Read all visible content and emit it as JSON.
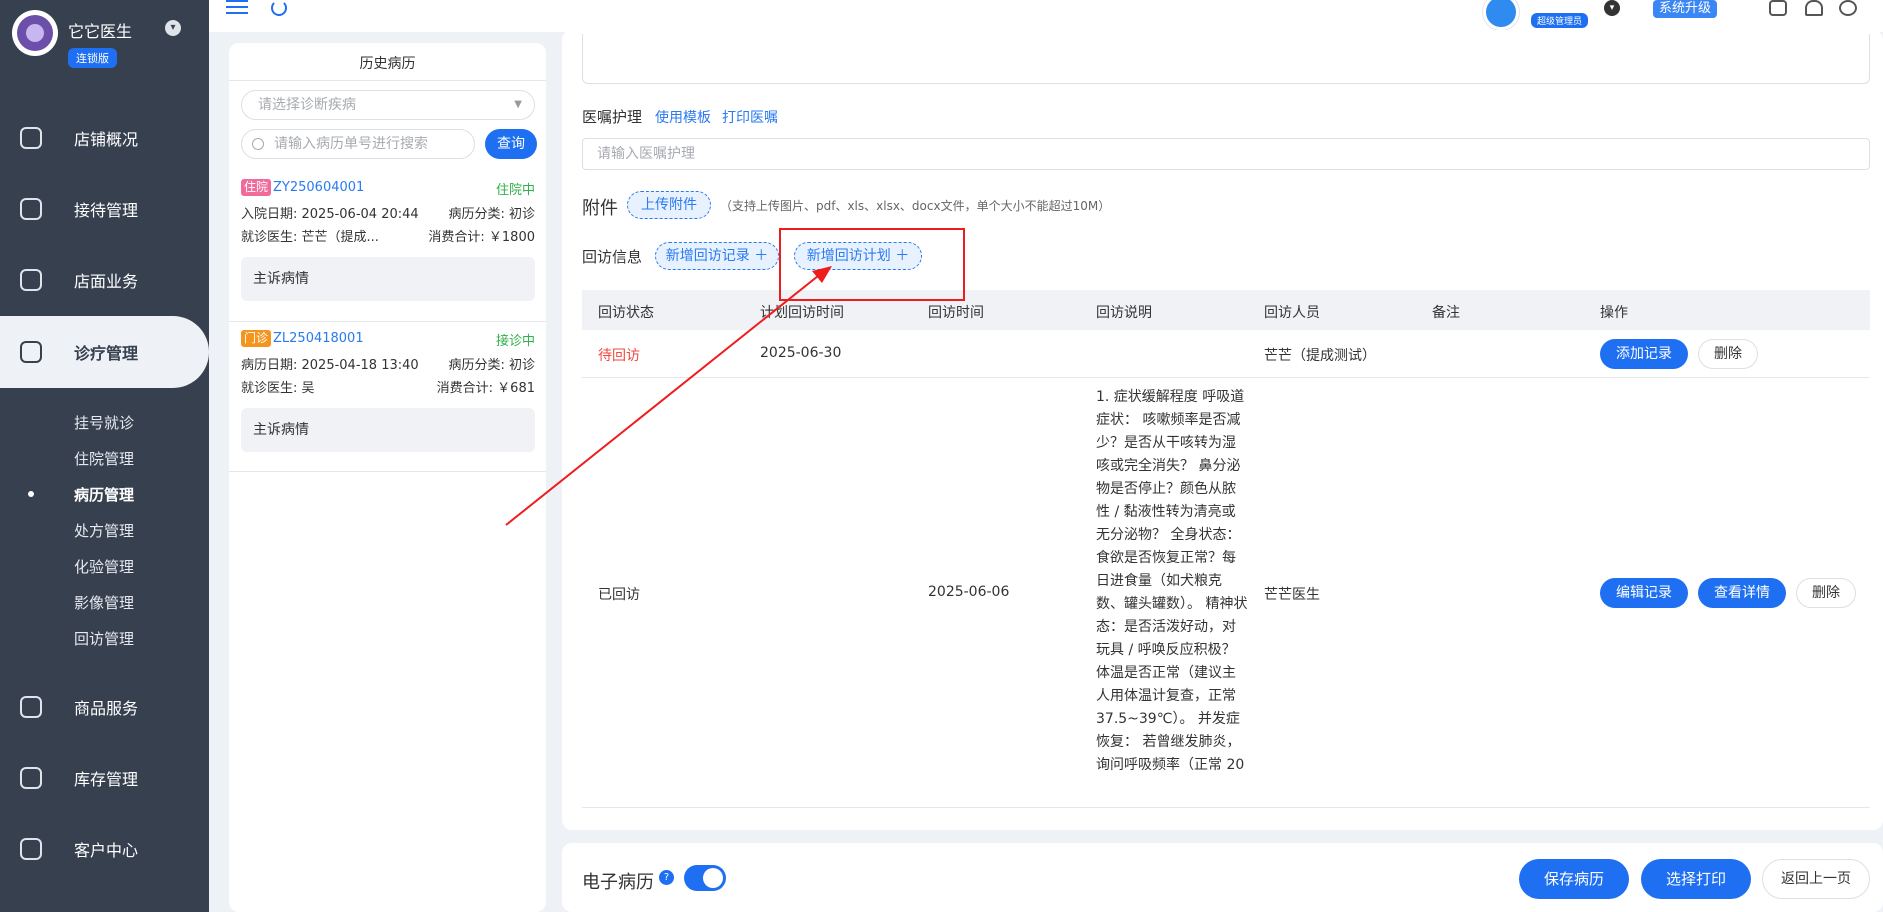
{
  "brand": {
    "name": "它它医生",
    "edition": "连锁版"
  },
  "sidebar": {
    "items": [
      {
        "label": "店铺概况",
        "icon": "dashboard-icon"
      },
      {
        "label": "接待管理",
        "icon": "reception-icon"
      },
      {
        "label": "店面业务",
        "icon": "store-icon"
      },
      {
        "label": "诊疗管理",
        "icon": "medical-kit-icon"
      },
      {
        "label": "商品服务",
        "icon": "goods-icon"
      },
      {
        "label": "库存管理",
        "icon": "inventory-icon"
      },
      {
        "label": "客户中心",
        "icon": "customer-icon"
      }
    ],
    "sub_items": [
      "挂号就诊",
      "住院管理",
      "病历管理",
      "处方管理",
      "化验管理",
      "影像管理",
      "回访管理"
    ]
  },
  "topbar": {
    "role_badge": "超级管理员",
    "upgrade": "系统升级"
  },
  "history": {
    "title": "历史病历",
    "select_placeholder": "请选择诊断疾病",
    "search_placeholder": "请输入病历单号进行搜索",
    "query_label": "查询",
    "records": [
      {
        "tag": "住院",
        "no": "ZY250604001",
        "status": "住院中",
        "date_line": "入院日期: 2025-06-04 20:44",
        "category": "病历分类: 初诊",
        "doctor": "就诊医生: 芒芒（提成...",
        "total": "消费合计: ￥1800",
        "complaint": "主诉病情"
      },
      {
        "tag": "门诊",
        "no": "ZL250418001",
        "status": "接诊中",
        "date_line": "病历日期: 2025-04-18 13:40",
        "category": "病历分类: 初诊",
        "doctor": "就诊医生: 吴",
        "total": "消费合计: ￥681",
        "complaint": "主诉病情"
      }
    ]
  },
  "main": {
    "care_label": "医嘱护理",
    "use_template": "使用模板",
    "print_care": "打印医嘱",
    "care_placeholder": "请输入医嘱护理",
    "attach_label": "附件",
    "upload_label": "上传附件",
    "upload_hint": "（支持上传图片、pdf、xls、xlsx、docx文件，单个大小不能超过10M）",
    "visit_label": "回访信息",
    "add_visit_record": "新增回访记录 ＋",
    "add_visit_plan": "新增回访计划 ＋",
    "table": {
      "headers": [
        "回访状态",
        "计划回访时间",
        "回访时间",
        "回访说明",
        "回访人员",
        "备注",
        "操作"
      ],
      "rows": [
        {
          "status": "待回访",
          "plan_time": "2025-06-30",
          "visit_time": "",
          "note": "",
          "person": "芒芒（提成测试）",
          "remark": "",
          "actions": [
            "添加记录",
            "删除"
          ]
        },
        {
          "status": "已回访",
          "plan_time": "",
          "visit_time": "2025-06-06",
          "note": "1. 症状缓解程度 呼吸道症状： 咳嗽频率是否减少？是否从干咳转为湿咳或完全消失？ 鼻分泌物是否停止？颜色从脓性 / 黏液性转为清亮或无分泌物？ 全身状态：食欲是否恢复正常？每日进食量（如犬粮克数、罐头罐数）。 精神状态：是否活泼好动，对玩具 / 呼唤反应积极？ 体温是否正常（建议主人用体温计复查，正常 37.5~39℃）。 并发症恢复： 若曾继发肺炎，询问呼吸频率（正常 20",
          "person": "芒芒医生",
          "remark": "",
          "actions": [
            "编辑记录",
            "查看详情",
            "删除"
          ]
        }
      ]
    }
  },
  "bottom": {
    "emr_label": "电子病历",
    "save": "保存病历",
    "print": "选择打印",
    "back": "返回上一页"
  },
  "colors": {
    "accent": "#1e6ff1",
    "sidebar": "#37404f",
    "annotation": "#ee1c1c"
  }
}
